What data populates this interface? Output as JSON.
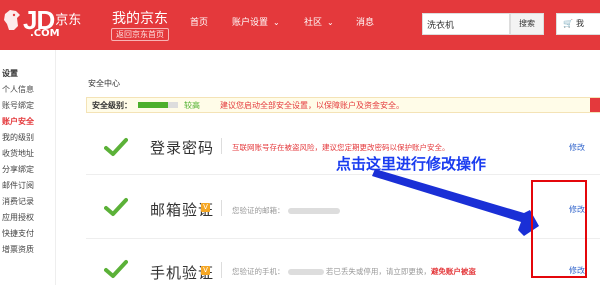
{
  "header": {
    "logo_text": "JD",
    "logo_cn": "京东",
    "logo_com": ".COM",
    "my_jd": "我的京东",
    "back_home": "返回京东首页",
    "nav": {
      "home": "首页",
      "account_settings": "账户设置",
      "community": "社区",
      "messages": "消息"
    },
    "search_value": "洗衣机",
    "search_button": "搜索",
    "cart_icon": "cart-icon",
    "cart_label": "我"
  },
  "sidebar": {
    "heading": "设置",
    "items": [
      "个人信息",
      "账号绑定",
      "账户安全",
      "我的级别",
      "收货地址",
      "分享绑定",
      "邮件订阅",
      "消费记录",
      "应用授权",
      "快捷支付",
      "增票资质"
    ],
    "active_index": 2
  },
  "main": {
    "title": "安全中心",
    "security_level_label": "安全级别：",
    "security_level_value": "较高",
    "security_level_fill": 0.75,
    "security_tip": "建议您启动全部安全设置，以保障账户及资金安全。",
    "items": [
      {
        "title": "登录密码",
        "verified": false,
        "description": "互联网账号存在被盗风险，建议您定期更改密码以保护账户安全。",
        "action": "修改"
      },
      {
        "title": "邮箱验证",
        "verified": true,
        "badge": "V",
        "description": "您验证的邮箱：",
        "action": "修改"
      },
      {
        "title": "手机验证",
        "verified": true,
        "badge": "V",
        "description": "您验证的手机：",
        "description_tail": "若已丢失或停用，请立即更换，",
        "danger_text": "避免账户被盗",
        "action": "修改"
      }
    ]
  },
  "annotation": {
    "text": "点击这里进行修改操作"
  },
  "colors": {
    "brand_red": "#e4393c",
    "check_green": "#5bb138",
    "annotation_blue": "#1a3cf0",
    "link_blue": "#3366cc"
  }
}
